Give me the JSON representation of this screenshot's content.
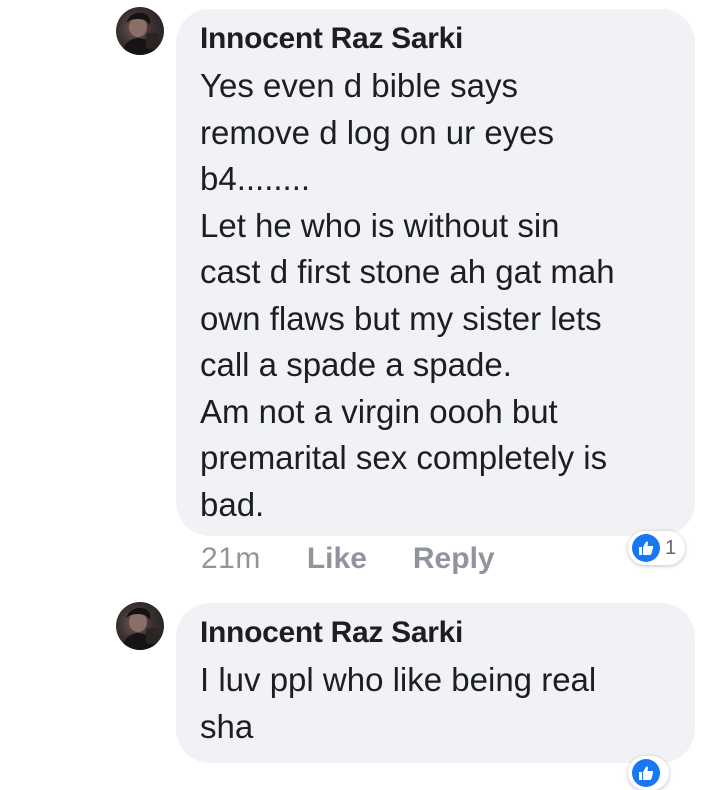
{
  "colors": {
    "bubble_bg": "#f0f2f5",
    "text": "#1c1e21",
    "meta": "#90949c",
    "like_blue": "#1877f2"
  },
  "comments": [
    {
      "author": "Innocent Raz Sarki",
      "lines": [
        "Yes even d bible says",
        "remove d log on ur eyes",
        "b4........",
        "Let he who is without sin",
        "cast d first stone ah gat mah",
        "own flaws but my sister lets",
        "call a spade a spade.",
        "Am not a virgin oooh but",
        "premarital sex completely is",
        "bad."
      ],
      "time": "21m",
      "like_label": "Like",
      "reply_label": "Reply",
      "reaction_icon": "thumbs-up-icon",
      "reaction_count": "1"
    },
    {
      "author": "Innocent Raz Sarki",
      "lines": [
        "I luv ppl who like being real",
        "sha"
      ],
      "reaction_icon": "thumbs-up-icon"
    }
  ]
}
